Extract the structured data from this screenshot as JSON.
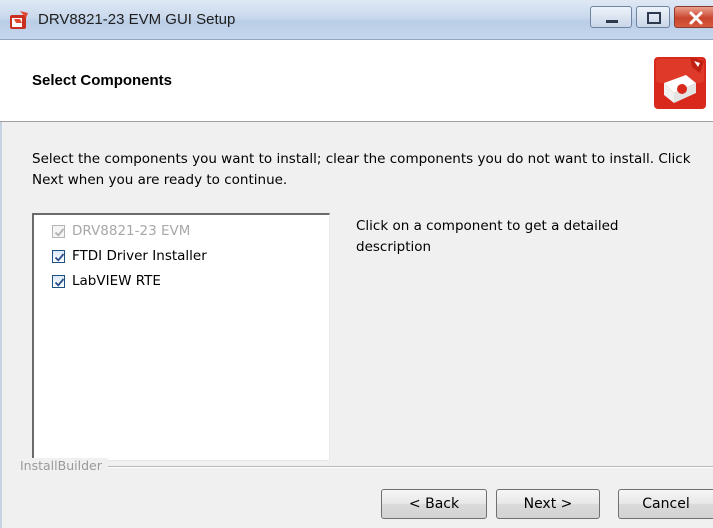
{
  "window": {
    "title": "DRV8821-23 EVM GUI Setup",
    "icon": "installer-app-icon",
    "controls": [
      "minimize-icon",
      "maximize-icon",
      "close-icon"
    ]
  },
  "header": {
    "title": "Select Components",
    "logo": "installer-box-logo"
  },
  "instructions": "Select the components you want to install; clear the components you do not want to install. Click Next when you are ready to continue.",
  "components": [
    {
      "label": "DRV8821-23 EVM",
      "checked": true,
      "enabled": false
    },
    {
      "label": "FTDI Driver Installer",
      "checked": true,
      "enabled": true
    },
    {
      "label": "LabVIEW RTE",
      "checked": true,
      "enabled": true
    }
  ],
  "description": "Click on a component to get a detailed description",
  "footer": {
    "brand": "InstallBuilder",
    "back_label": "< Back",
    "next_label": "Next >",
    "cancel_label": "Cancel"
  },
  "colors": {
    "accent_red": "#d8291c",
    "checkbox_border": "#1c5180",
    "checkmark": "#2a4f8a"
  }
}
